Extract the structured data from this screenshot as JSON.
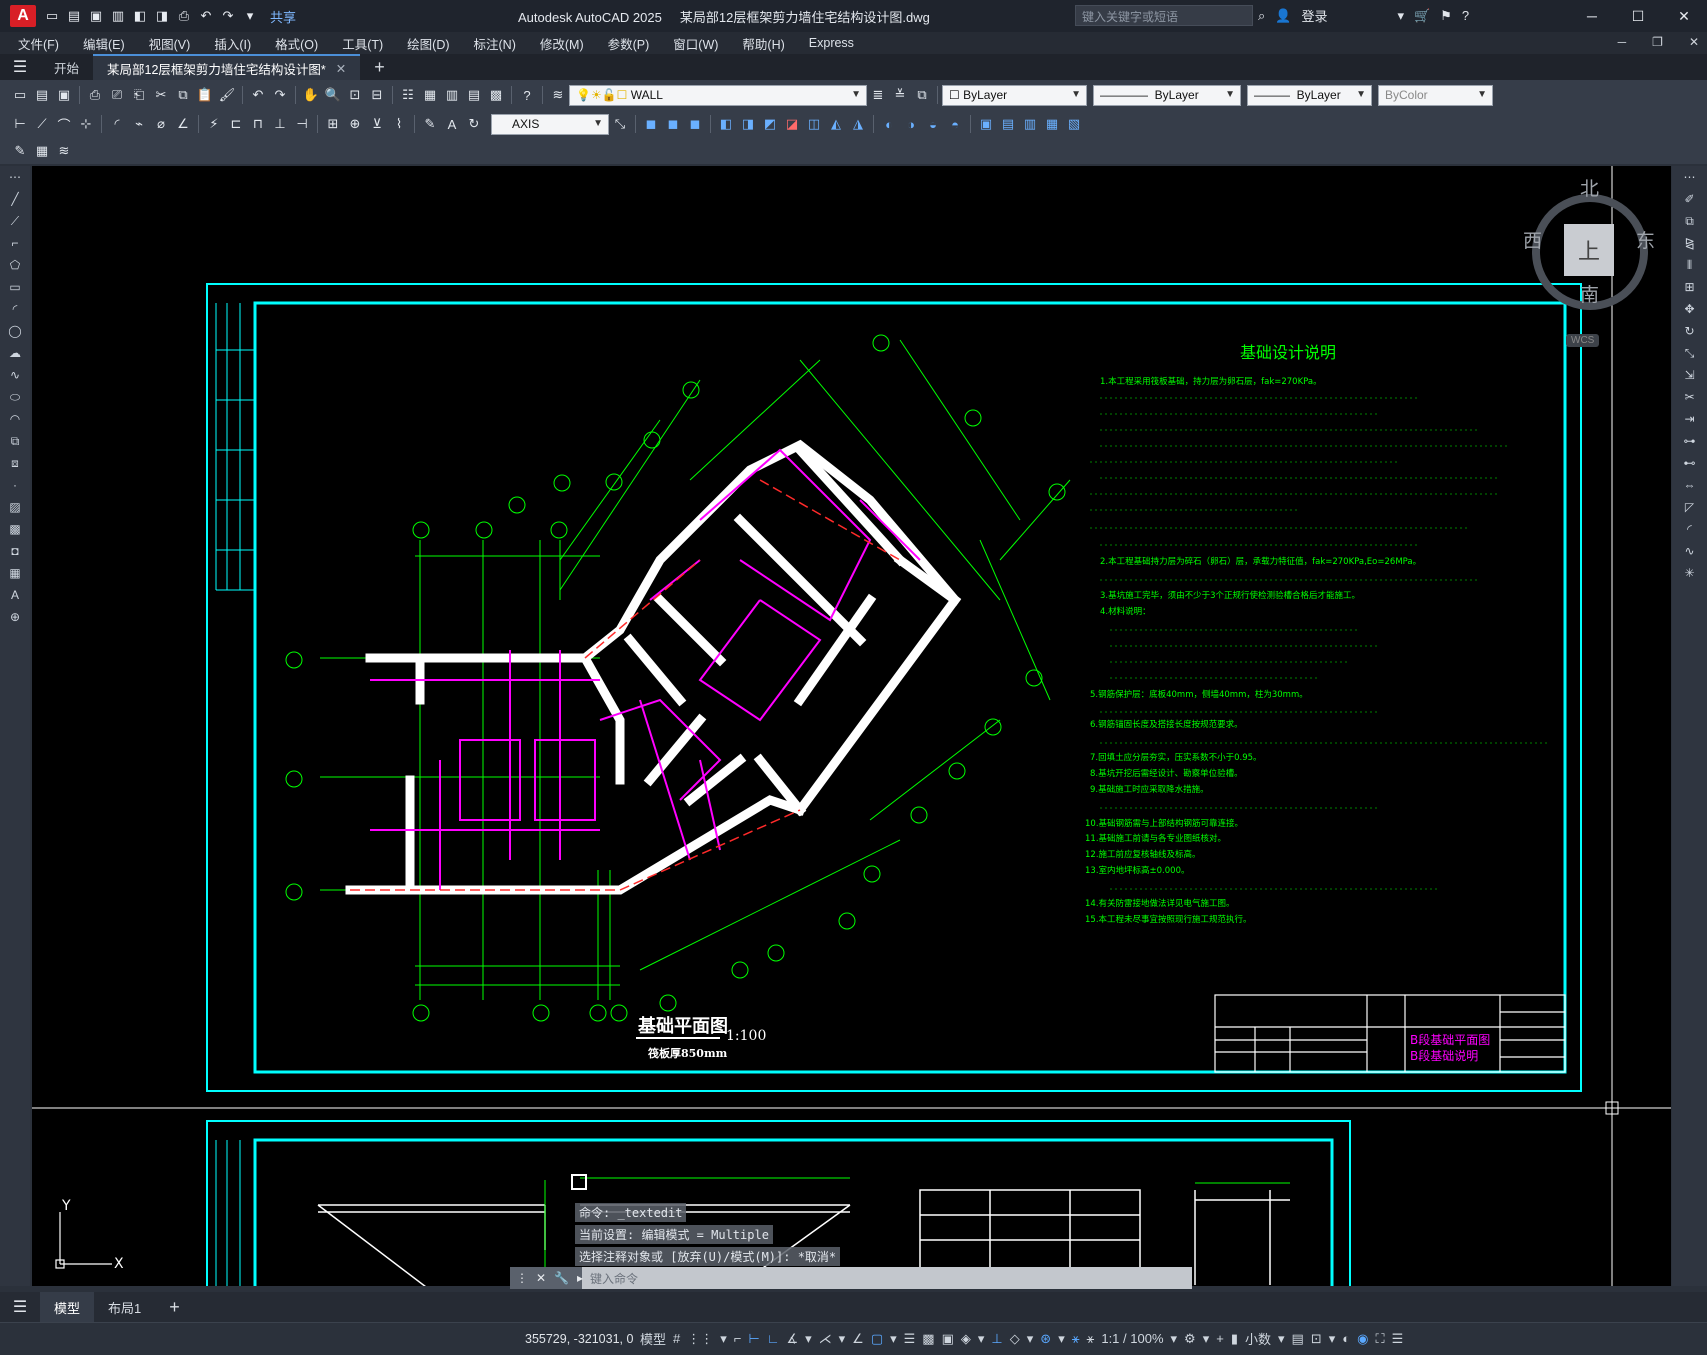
{
  "window": {
    "app_name": "Autodesk AutoCAD 2025",
    "file_name": "某局部12层框架剪力墙住宅结构设计图.dwg",
    "share_label": "共享",
    "search_placeholder": "键入关键字或短语",
    "login_label": "登录"
  },
  "menu": [
    "文件(F)",
    "编辑(E)",
    "视图(V)",
    "插入(I)",
    "格式(O)",
    "工具(T)",
    "绘图(D)",
    "标注(N)",
    "修改(M)",
    "参数(P)",
    "窗口(W)",
    "帮助(H)",
    "Express"
  ],
  "tabs": {
    "start": "开始",
    "document": "某局部12层框架剪力墙住宅结构设计图*"
  },
  "toolbar": {
    "layer_name": "WALL",
    "color": "ByLayer",
    "linetype": "ByLayer",
    "lineweight": "ByLayer",
    "plotstyle": "ByColor",
    "dimstyle": "AXIS"
  },
  "viewcube": {
    "north": "北",
    "south": "南",
    "east": "东",
    "west": "西",
    "face": "上",
    "wcs": "WCS"
  },
  "drawing": {
    "notes_title": "基础设计说明",
    "plan_title": "基础平面图",
    "plan_scale": "1:100",
    "plan_subtitle": "筏板厚850mm",
    "sheet_title_1": "B段基础平面图",
    "sheet_title_2": "B段基础说明",
    "notes": [
      "1.本工程采用筏板基础，持力层为卵石层，fak=270KPa。",
      "2.本工程基础持力层为碎石（卵石）层，承载力特征值，fak=270KPa,Eo=26MPa。",
      "3.基坑施工完毕，须由不少于3个正规行使检测验槽合格后才能施工。",
      "4.材料说明：",
      "5.钢筋保护层：底板40mm，侧墙40mm，柱为30mm。",
      "6.钢筋锚固长度及搭接长度按规范要求。",
      "7.回填土应分层夯实，压实系数不小于0.95。",
      "8.基坑开挖后需经设计、勘察单位验槽。",
      "9.基础施工时应采取降水措施。",
      "10.基础钢筋需与上部结构钢筋可靠连接。",
      "11.基础施工前请与各专业图纸核对。",
      "12.施工前应复核轴线及标高。",
      "13.室内地坪标高±0.000。",
      "14.有关防雷接地做法详见电气施工图。",
      "15.本工程未尽事宜按照现行施工规范执行。"
    ]
  },
  "command": {
    "line1": "命令: _textedit",
    "line2": "当前设置: 编辑模式 = Multiple",
    "line3": "选择注释对象或 [放弃(U)/模式(M)]: *取消*",
    "placeholder": "键入命令"
  },
  "layouts": {
    "model": "模型",
    "layout1": "布局1"
  },
  "status": {
    "coords": "355729, -321031, 0",
    "model": "模型",
    "scale": "1:1 / 100%",
    "units": "小数"
  },
  "colors": {
    "frame": "#00ffff",
    "text": "#00ff00",
    "wall": "#ffffff",
    "rebar": "#ff00ff",
    "axis": "#ff0000"
  }
}
